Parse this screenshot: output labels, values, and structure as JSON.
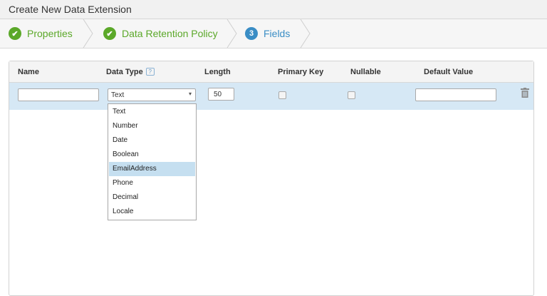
{
  "window": {
    "title": "Create New Data Extension"
  },
  "wizard": {
    "steps": [
      {
        "label": "Properties",
        "state": "done",
        "marker": "✔"
      },
      {
        "label": "Data Retention Policy",
        "state": "done",
        "marker": "✔"
      },
      {
        "label": "Fields",
        "state": "active",
        "marker": "3"
      }
    ]
  },
  "grid": {
    "headers": {
      "name": "Name",
      "data_type": "Data Type",
      "data_type_help": "?",
      "length": "Length",
      "primary_key": "Primary Key",
      "nullable": "Nullable",
      "default_value": "Default Value"
    },
    "row": {
      "name_value": "",
      "data_type_value": "Text",
      "length_value": "50",
      "primary_key_checked": false,
      "nullable_checked": false,
      "default_value": ""
    },
    "data_type_options": [
      "Text",
      "Number",
      "Date",
      "Boolean",
      "EmailAddress",
      "Phone",
      "Decimal",
      "Locale"
    ],
    "highlighted_option": "EmailAddress"
  },
  "colors": {
    "done": "#5ba829",
    "active": "#3a8dc5",
    "row_selected": "#d6e8f5",
    "option_highlight": "#c5dff0"
  },
  "icons": {
    "step_done": "check-circle-icon",
    "step_active": "number-circle-icon",
    "delete": "trash-icon",
    "dropdown": "chevron-down-icon"
  }
}
